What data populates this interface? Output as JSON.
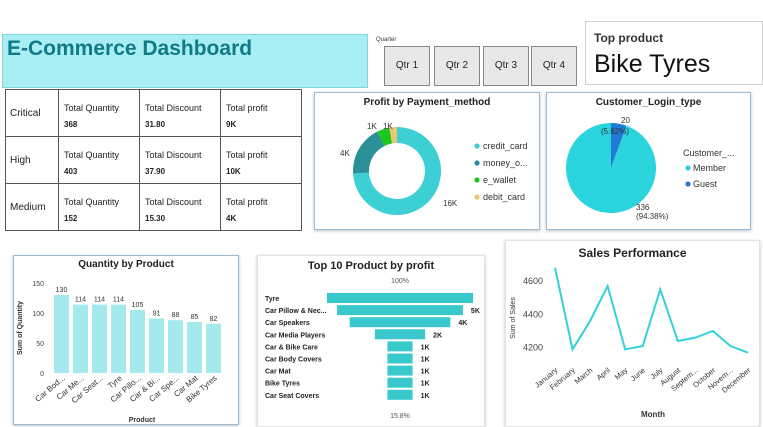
{
  "header": {
    "title": "E-Commerce Dashboard",
    "quarter_label": "Quarter",
    "quarters": [
      "Qtr 1",
      "Qtr 2",
      "Qtr 3",
      "Qtr 4"
    ],
    "top_product_label": "Top product",
    "top_product_value": "Bike Tyres"
  },
  "matrix": {
    "rows": [
      {
        "label": "Critical",
        "cells": [
          {
            "label": "Total Quantity",
            "value": "368"
          },
          {
            "label": "Total Discount",
            "value": "31.80"
          },
          {
            "label": "Total profit",
            "value": "9K"
          }
        ]
      },
      {
        "label": "High",
        "cells": [
          {
            "label": "Total Quantity",
            "value": "403"
          },
          {
            "label": "Total Discount",
            "value": "37.90"
          },
          {
            "label": "Total profit",
            "value": "10K"
          }
        ]
      },
      {
        "label": "Medium",
        "cells": [
          {
            "label": "Total Quantity",
            "value": "152"
          },
          {
            "label": "Total Discount",
            "value": "15.30"
          },
          {
            "label": "Total profit",
            "value": "4K"
          }
        ]
      }
    ]
  },
  "colors": {
    "teal": "#32d2d8",
    "teal_light": "#a4e9ec",
    "credit_card": "#3ccfd4",
    "money_order": "#2a8f96",
    "e_wallet": "#1ec71e",
    "debit_card": "#e8c776",
    "member": "#2bd4dc",
    "guest": "#1f7bd4",
    "funnel": "#39c9cc"
  },
  "chart_data": [
    {
      "type": "pie",
      "variant": "donut",
      "title": "Profit by Payment_method",
      "slices": [
        {
          "name": "credit_card",
          "value": 16,
          "label": "16K"
        },
        {
          "name": "money_o...",
          "value": 4,
          "label": "4K"
        },
        {
          "name": "e_wallet",
          "value": 1,
          "label": "1K"
        },
        {
          "name": "debit_card",
          "value": 0.6,
          "label": "1K"
        }
      ],
      "legend_position": "right"
    },
    {
      "type": "pie",
      "title": "Customer_Login_type",
      "legend_title": "Customer_...",
      "slices": [
        {
          "name": "Member",
          "value": 336,
          "label": "336",
          "pct": "(94.38%)"
        },
        {
          "name": "Guest",
          "value": 20,
          "label": "20",
          "pct": "(5.62%)"
        }
      ],
      "legend_position": "right"
    },
    {
      "type": "bar",
      "title": "Quantity by Product",
      "xlabel": "Product",
      "ylabel": "Sum of Quantity",
      "categories": [
        "Car Bod...",
        "Car Me...",
        "Car Seat...",
        "Tyre",
        "Car Pillo...",
        "Car & Bi...",
        "Car Spe...",
        "Car Mat",
        "Bike Tyres"
      ],
      "values": [
        130,
        114,
        114,
        114,
        105,
        91,
        88,
        85,
        82
      ],
      "yticks": [
        0,
        50,
        100,
        150
      ],
      "ylim": [
        0,
        150
      ],
      "grid": false
    },
    {
      "type": "bar",
      "variant": "funnel",
      "title": "Top 10 Product by profit",
      "top_label": "100%",
      "bottom_label": "15.8%",
      "categories": [
        "Tyre",
        "Car Pillow & Nec...",
        "Car Speakers",
        "Car Media Players",
        "Car & Bike Care",
        "Car Body Covers",
        "Car Mat",
        "Bike Tyres",
        "Car Seat Covers"
      ],
      "values": [
        5.8,
        5.0,
        4.0,
        2.0,
        1.0,
        1.0,
        1.0,
        1.0,
        1.0
      ],
      "labels": [
        "",
        "5K",
        "4K",
        "2K",
        "1K",
        "1K",
        "1K",
        "1K",
        "1K"
      ]
    },
    {
      "type": "line",
      "title": "Sales Performance",
      "xlabel": "Month",
      "ylabel": "Sum of Sales",
      "categories": [
        "January",
        "February",
        "March",
        "April",
        "May",
        "June",
        "July",
        "August",
        "Septem...",
        "October",
        "Novem...",
        "December"
      ],
      "values": [
        4680,
        4190,
        4360,
        4570,
        4190,
        4210,
        4550,
        4240,
        4260,
        4300,
        4210,
        4170
      ],
      "yticks": [
        4200,
        4400,
        4600
      ],
      "ylim": [
        4120,
        4720
      ],
      "grid": false
    }
  ]
}
